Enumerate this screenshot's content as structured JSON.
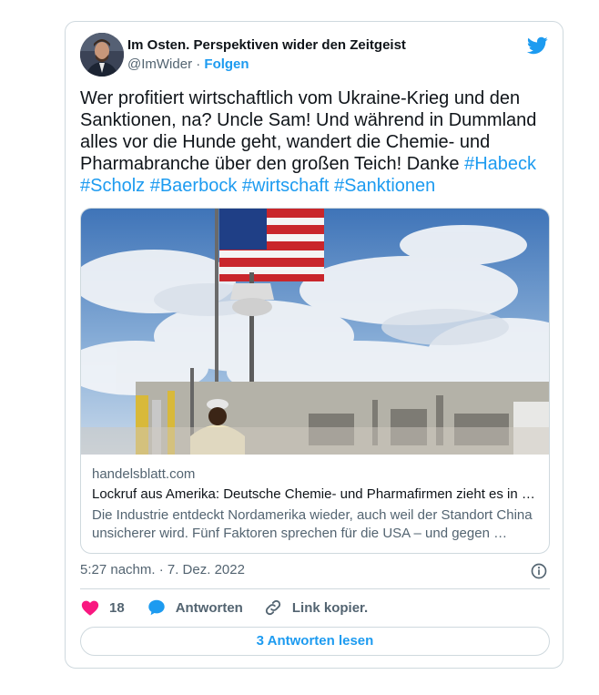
{
  "tweet": {
    "author_name": "Im Osten. Perspektiven wider den Zeitgeist",
    "handle": "@ImWider",
    "separator": "·",
    "follow_label": "Folgen",
    "text": "Wer profitiert wirtschaftlich vom Ukraine-Krieg und den Sanktionen, na? Uncle Sam! Und während in Dummland alles vor die Hunde geht, wandert die Chemie- und Pharmabranche über den großen Teich! Danke ",
    "hashtags": [
      "#Habeck",
      "#Scholz",
      "#Baerbock",
      "#wirtschaft",
      "#Sanktionen"
    ],
    "link_card": {
      "domain": "handelsblatt.com",
      "title": "Lockruf aus Amerika: Deutsche Chemie- und Pharmafirmen zieht es in die USA",
      "description": "Die Industrie entdeckt Nordamerika wieder, auch weil der Standort China unsicherer wird. Fünf Faktoren sprechen für die USA – und gegen …"
    },
    "timestamp": "5:27 nachm. · 7. Dez. 2022",
    "likes": "18",
    "reply_label": "Antworten",
    "copy_link_label": "Link kopier.",
    "read_replies_label": "3 Antworten lesen"
  },
  "colors": {
    "accent": "#1d9bf0",
    "like": "#f91880",
    "border": "#cfd9de",
    "muted": "#536471"
  },
  "icons": [
    "twitter-bird-icon",
    "heart-icon",
    "reply-bubble-icon",
    "link-icon",
    "info-icon"
  ]
}
